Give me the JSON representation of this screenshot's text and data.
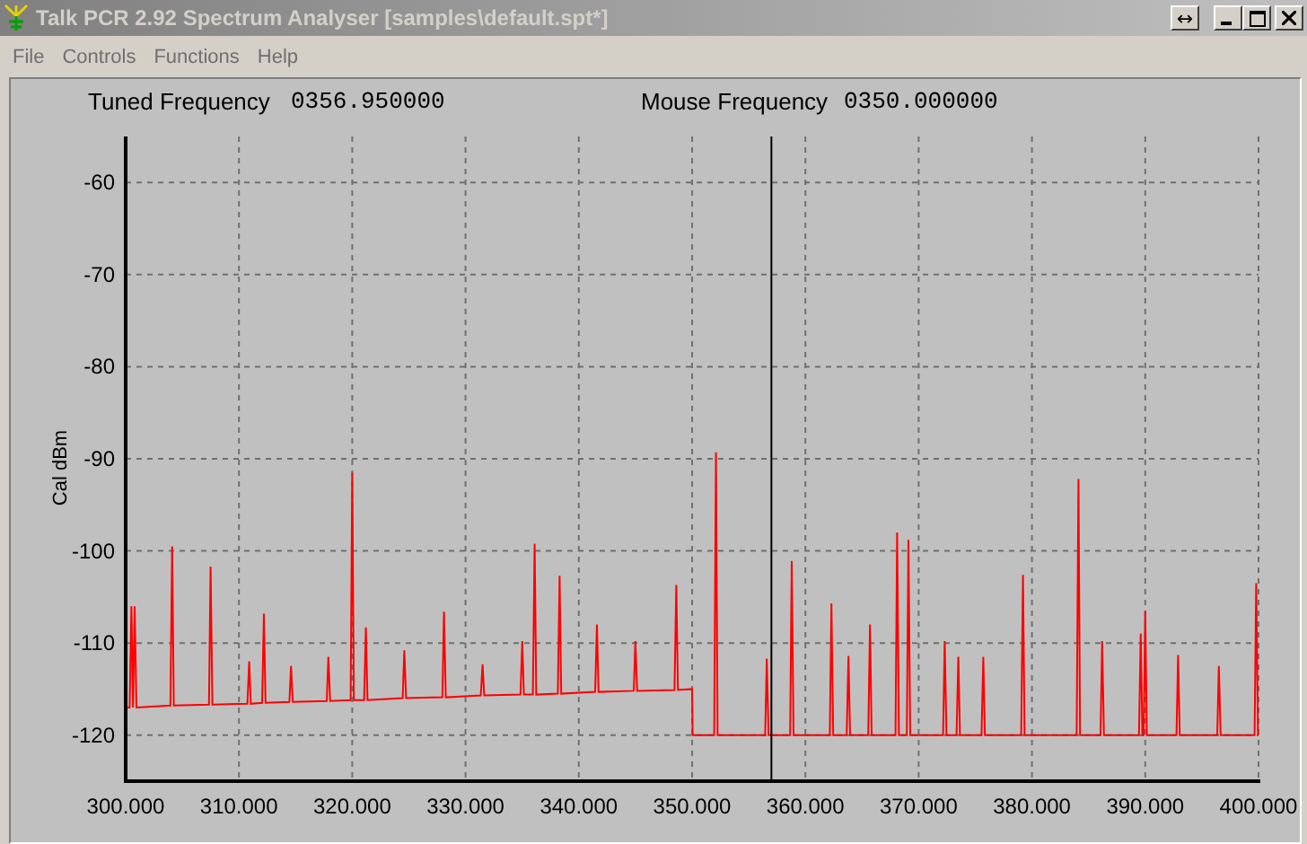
{
  "window": {
    "title": "Talk PCR 2.92 Spectrum Analyser [samples\\default.spt*]",
    "extra_button": "↔"
  },
  "menu": [
    "File",
    "Controls",
    "Functions",
    "Help"
  ],
  "readouts": [
    {
      "label": "Tuned Frequency",
      "value": "0356.950000"
    },
    {
      "label": "Mouse Frequency",
      "value": "0350.000000"
    }
  ],
  "chart_data": {
    "type": "line",
    "ylabel": "Cal dBm",
    "xlim": [
      300,
      400
    ],
    "ylim": [
      -125,
      -55
    ],
    "xticks": [
      {
        "value": 300,
        "label": "300.000"
      },
      {
        "value": 310,
        "label": "310.000"
      },
      {
        "value": 320,
        "label": "320.000"
      },
      {
        "value": 330,
        "label": "330.000"
      },
      {
        "value": 340,
        "label": "340.000"
      },
      {
        "value": 350,
        "label": "350.000"
      },
      {
        "value": 360,
        "label": "360.000"
      },
      {
        "value": 370,
        "label": "370.000"
      },
      {
        "value": 380,
        "label": "380.000"
      },
      {
        "value": 390,
        "label": "390.000"
      },
      {
        "value": 400,
        "label": "400.000"
      }
    ],
    "yticks": [
      -60,
      -70,
      -80,
      -90,
      -100,
      -110,
      -120
    ],
    "x": [
      300,
      300.35,
      300.5,
      300.65,
      300.8,
      300.95,
      303.95,
      304.1,
      304.25,
      307.35,
      307.5,
      307.65,
      310.75,
      310.9,
      311.05,
      312.05,
      312.2,
      312.35,
      314.45,
      314.6,
      314.75,
      317.75,
      317.9,
      318.05,
      319.85,
      320,
      320.15,
      321.05,
      321.2,
      321.35,
      324.45,
      324.6,
      324.75,
      327.95,
      328.1,
      328.25,
      331.35,
      331.5,
      331.65,
      334.85,
      335,
      335.15,
      335.95,
      336.1,
      336.25,
      338.15,
      338.3,
      338.45,
      341.45,
      341.6,
      341.75,
      344.85,
      345,
      345.15,
      348.45,
      348.6,
      348.75,
      350,
      350.05,
      351.95,
      352.1,
      352.25,
      356.45,
      356.6,
      356.75,
      358.65,
      358.8,
      358.95,
      362.15,
      362.3,
      362.45,
      363.65,
      363.8,
      363.95,
      365.55,
      365.7,
      365.85,
      367.95,
      368.1,
      368.25,
      368.95,
      369.1,
      369.25,
      372.15,
      372.3,
      372.45,
      373.35,
      373.5,
      373.65,
      375.55,
      375.7,
      375.85,
      379.05,
      379.2,
      379.35,
      383.95,
      384.1,
      384.25,
      386.05,
      386.2,
      386.35,
      389.45,
      389.6,
      389.75,
      389.85,
      390,
      390.15,
      392.75,
      392.9,
      393.05,
      396.35,
      396.5,
      396.65,
      399.65,
      399.8,
      399.95,
      400
    ],
    "series": [
      {
        "color": "#ff0000",
        "values": [
          -117,
          -117,
          -106,
          -117,
          -106,
          -117,
          -116.8,
          -99.5,
          -116.8,
          -116.7,
          -101.7,
          -116.7,
          -116.6,
          -112,
          -116.6,
          -116.5,
          -106.8,
          -116.5,
          -116.4,
          -112.5,
          -116.4,
          -116.3,
          -111.5,
          -116.3,
          -116.2,
          -91.5,
          -116.2,
          -116.2,
          -108.3,
          -116.2,
          -116,
          -110.8,
          -116,
          -115.9,
          -106.6,
          -115.9,
          -115.7,
          -112.3,
          -115.7,
          -115.6,
          -109.8,
          -115.6,
          -115.6,
          -99.2,
          -115.6,
          -115.5,
          -102.7,
          -115.5,
          -115.3,
          -108,
          -115.3,
          -115.2,
          -109.8,
          -115.2,
          -115.1,
          -103.7,
          -115.1,
          -115,
          -120,
          -120,
          -89.3,
          -120,
          -120,
          -111.7,
          -120,
          -120,
          -101.1,
          -120,
          -120,
          -105.7,
          -120,
          -120,
          -111.4,
          -120,
          -120,
          -108,
          -120,
          -120,
          -98,
          -120,
          -120,
          -98.8,
          -120,
          -120,
          -109.8,
          -120,
          -120,
          -111.5,
          -120,
          -120,
          -111.5,
          -120,
          -120,
          -102.6,
          -120,
          -120,
          -92.2,
          -120,
          -120,
          -109.8,
          -120,
          -120,
          -109,
          -120,
          -120,
          -106.5,
          -120,
          -120,
          -111.3,
          -120,
          -120,
          -112.5,
          -120,
          -120,
          -103.5,
          -120,
          -120
        ]
      }
    ],
    "grid": true,
    "ref_lines": [
      {
        "axis": "x",
        "value": 357,
        "color": "#000000"
      }
    ]
  }
}
